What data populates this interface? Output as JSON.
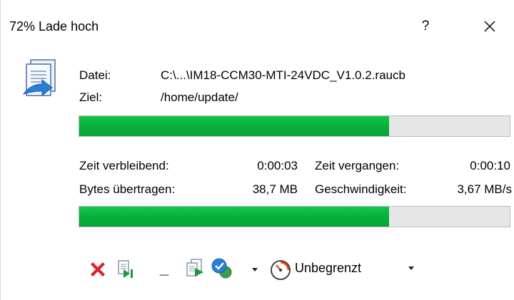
{
  "window": {
    "title": "72% Lade hoch",
    "help_label": "?"
  },
  "info": {
    "file_label": "Datei:",
    "file_value": "C:\\...\\IM18-CCM30-MTI-24VDC_V1.0.2.raucb",
    "target_label": "Ziel:",
    "target_value": "/home/update/"
  },
  "progress": {
    "file_fraction": 0.72,
    "total_fraction": 0.72
  },
  "stats": {
    "remaining_label": "Zeit verbleibend:",
    "remaining_value": "0:00:03",
    "elapsed_label": "Zeit vergangen:",
    "elapsed_value": "0:00:10",
    "bytes_label": "Bytes übertragen:",
    "bytes_value": "38,7 MB",
    "speed_label": "Geschwindigkeit:",
    "speed_value": "3,67 MB/s"
  },
  "toolbar": {
    "speed_limit_label": "Unbegrenzt",
    "minimize_label": "_"
  },
  "colors": {
    "progress_green": "#08b53e",
    "cancel_red": "#d8232a",
    "accent_blue": "#2a7fd4"
  }
}
